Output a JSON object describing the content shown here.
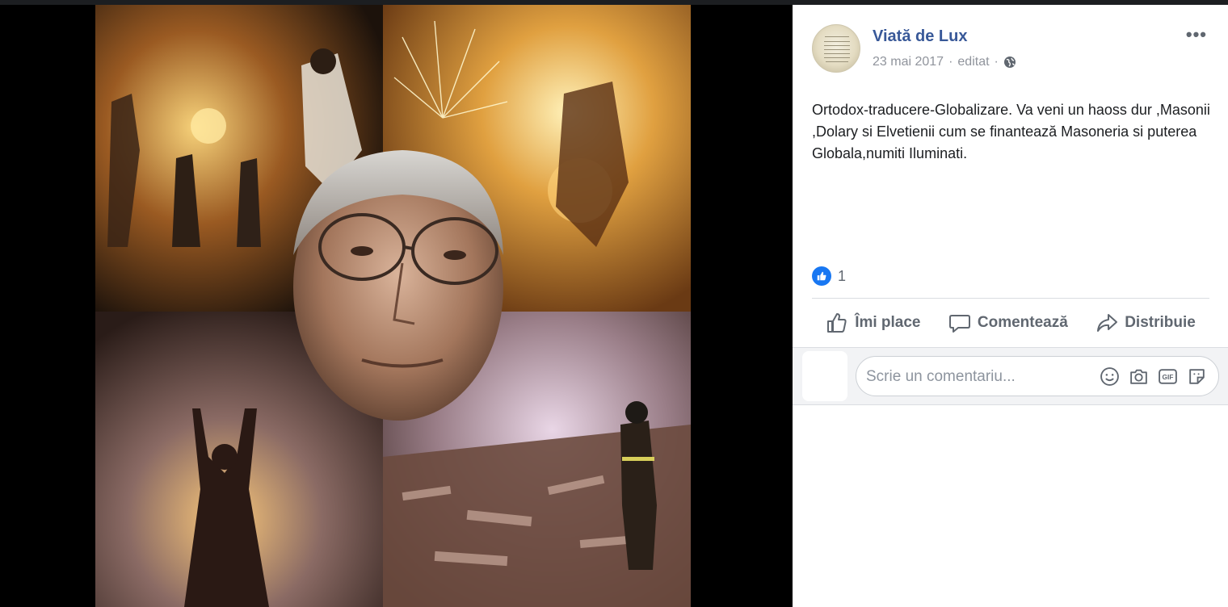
{
  "post": {
    "author": "Viată de Lux",
    "date": "23 mai 2017",
    "separator": "·",
    "edited": "editat",
    "more_label": "•••",
    "text": "Ortodox-traducere-Globalizare. Va veni un haoss dur ,Masonii ,Dolary si Elvetienii cum se finantează Masoneria si puterea Globala,numiti Iluminati."
  },
  "reactions": {
    "count": "1",
    "icon": "like-icon"
  },
  "actions": {
    "like": "Îmi place",
    "comment": "Comentează",
    "share": "Distribuie"
  },
  "comment": {
    "placeholder": "Scrie un comentariu...",
    "icons": [
      "emoji-icon",
      "camera-icon",
      "gif-icon",
      "sticker-icon"
    ]
  },
  "colors": {
    "author": "#385898",
    "action_text": "#606770",
    "like_blue": "#1877f2",
    "panel_bg": "#ffffff"
  }
}
